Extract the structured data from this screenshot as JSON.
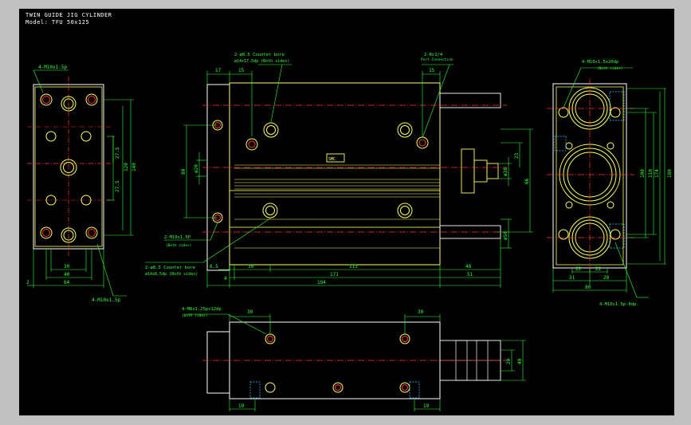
{
  "header": {
    "title": "TWIN GUIDE JIG CYLINDER",
    "model": "Model: TFU 50x125"
  },
  "colors": {
    "background": "#000000",
    "outline": "#ffffff",
    "body": "#ffff66",
    "dimension": "#33ff33",
    "centerline": "#ff3333",
    "hidden": "#33ccff"
  },
  "left_view": {
    "tap_top": "4-M10x1.5p",
    "tap_bottom": "4-M10x1.5p",
    "dims_v": [
      "27.5",
      "27.5",
      "120",
      "140"
    ],
    "dims_h": [
      "30",
      "40",
      "64",
      "2"
    ]
  },
  "front_view": {
    "callout_cbore_top": "2-ø8.5 Counter bore",
    "callout_cbore_top_sub": "ø14x17.5dp (Both sides)",
    "callout_port": "2-Rc1/4",
    "callout_port_sub": "Port Connection",
    "callout_tap": "2-M10x1.5P",
    "callout_tap_sub": "(Both sides)",
    "callout_cbore_bot": "2-ø8.5 Counter bore",
    "callout_cbore_bot_sub": "ø14x8.5dp (Both sides)",
    "dim_17": "17",
    "dim_15a": "15",
    "dim_15b": "15",
    "dim_80": "80",
    "dim_d20": "ø20",
    "dim_d38": "ø38",
    "dim_23": "23",
    "dim_66": "66",
    "dim_d50": "ø50",
    "dim_30": "30",
    "dim_65": "6.5",
    "dim_113": "113",
    "dim_48": "48",
    "dim_4": "4",
    "dim_171": "171",
    "dim_51": "51",
    "dim_194": "194"
  },
  "right_view": {
    "callout_top": "4-M10x1.5x20dp",
    "callout_top_sub": "(Both sides)",
    "callout_bottom": "4-M10x1.5p-8dp.",
    "dims_v": [
      "100",
      "110",
      "174",
      "180"
    ],
    "dims_h": [
      "22",
      "22",
      "31",
      "28",
      "80"
    ]
  },
  "bottom_view": {
    "callout": "4-M8x1.25px12dp",
    "callout_sub": "(Both sides)",
    "dim_30a": "30",
    "dim_30b": "30",
    "dim_20": "20",
    "dim_40": "40",
    "dim_19a": "19",
    "dim_19b": "19"
  }
}
